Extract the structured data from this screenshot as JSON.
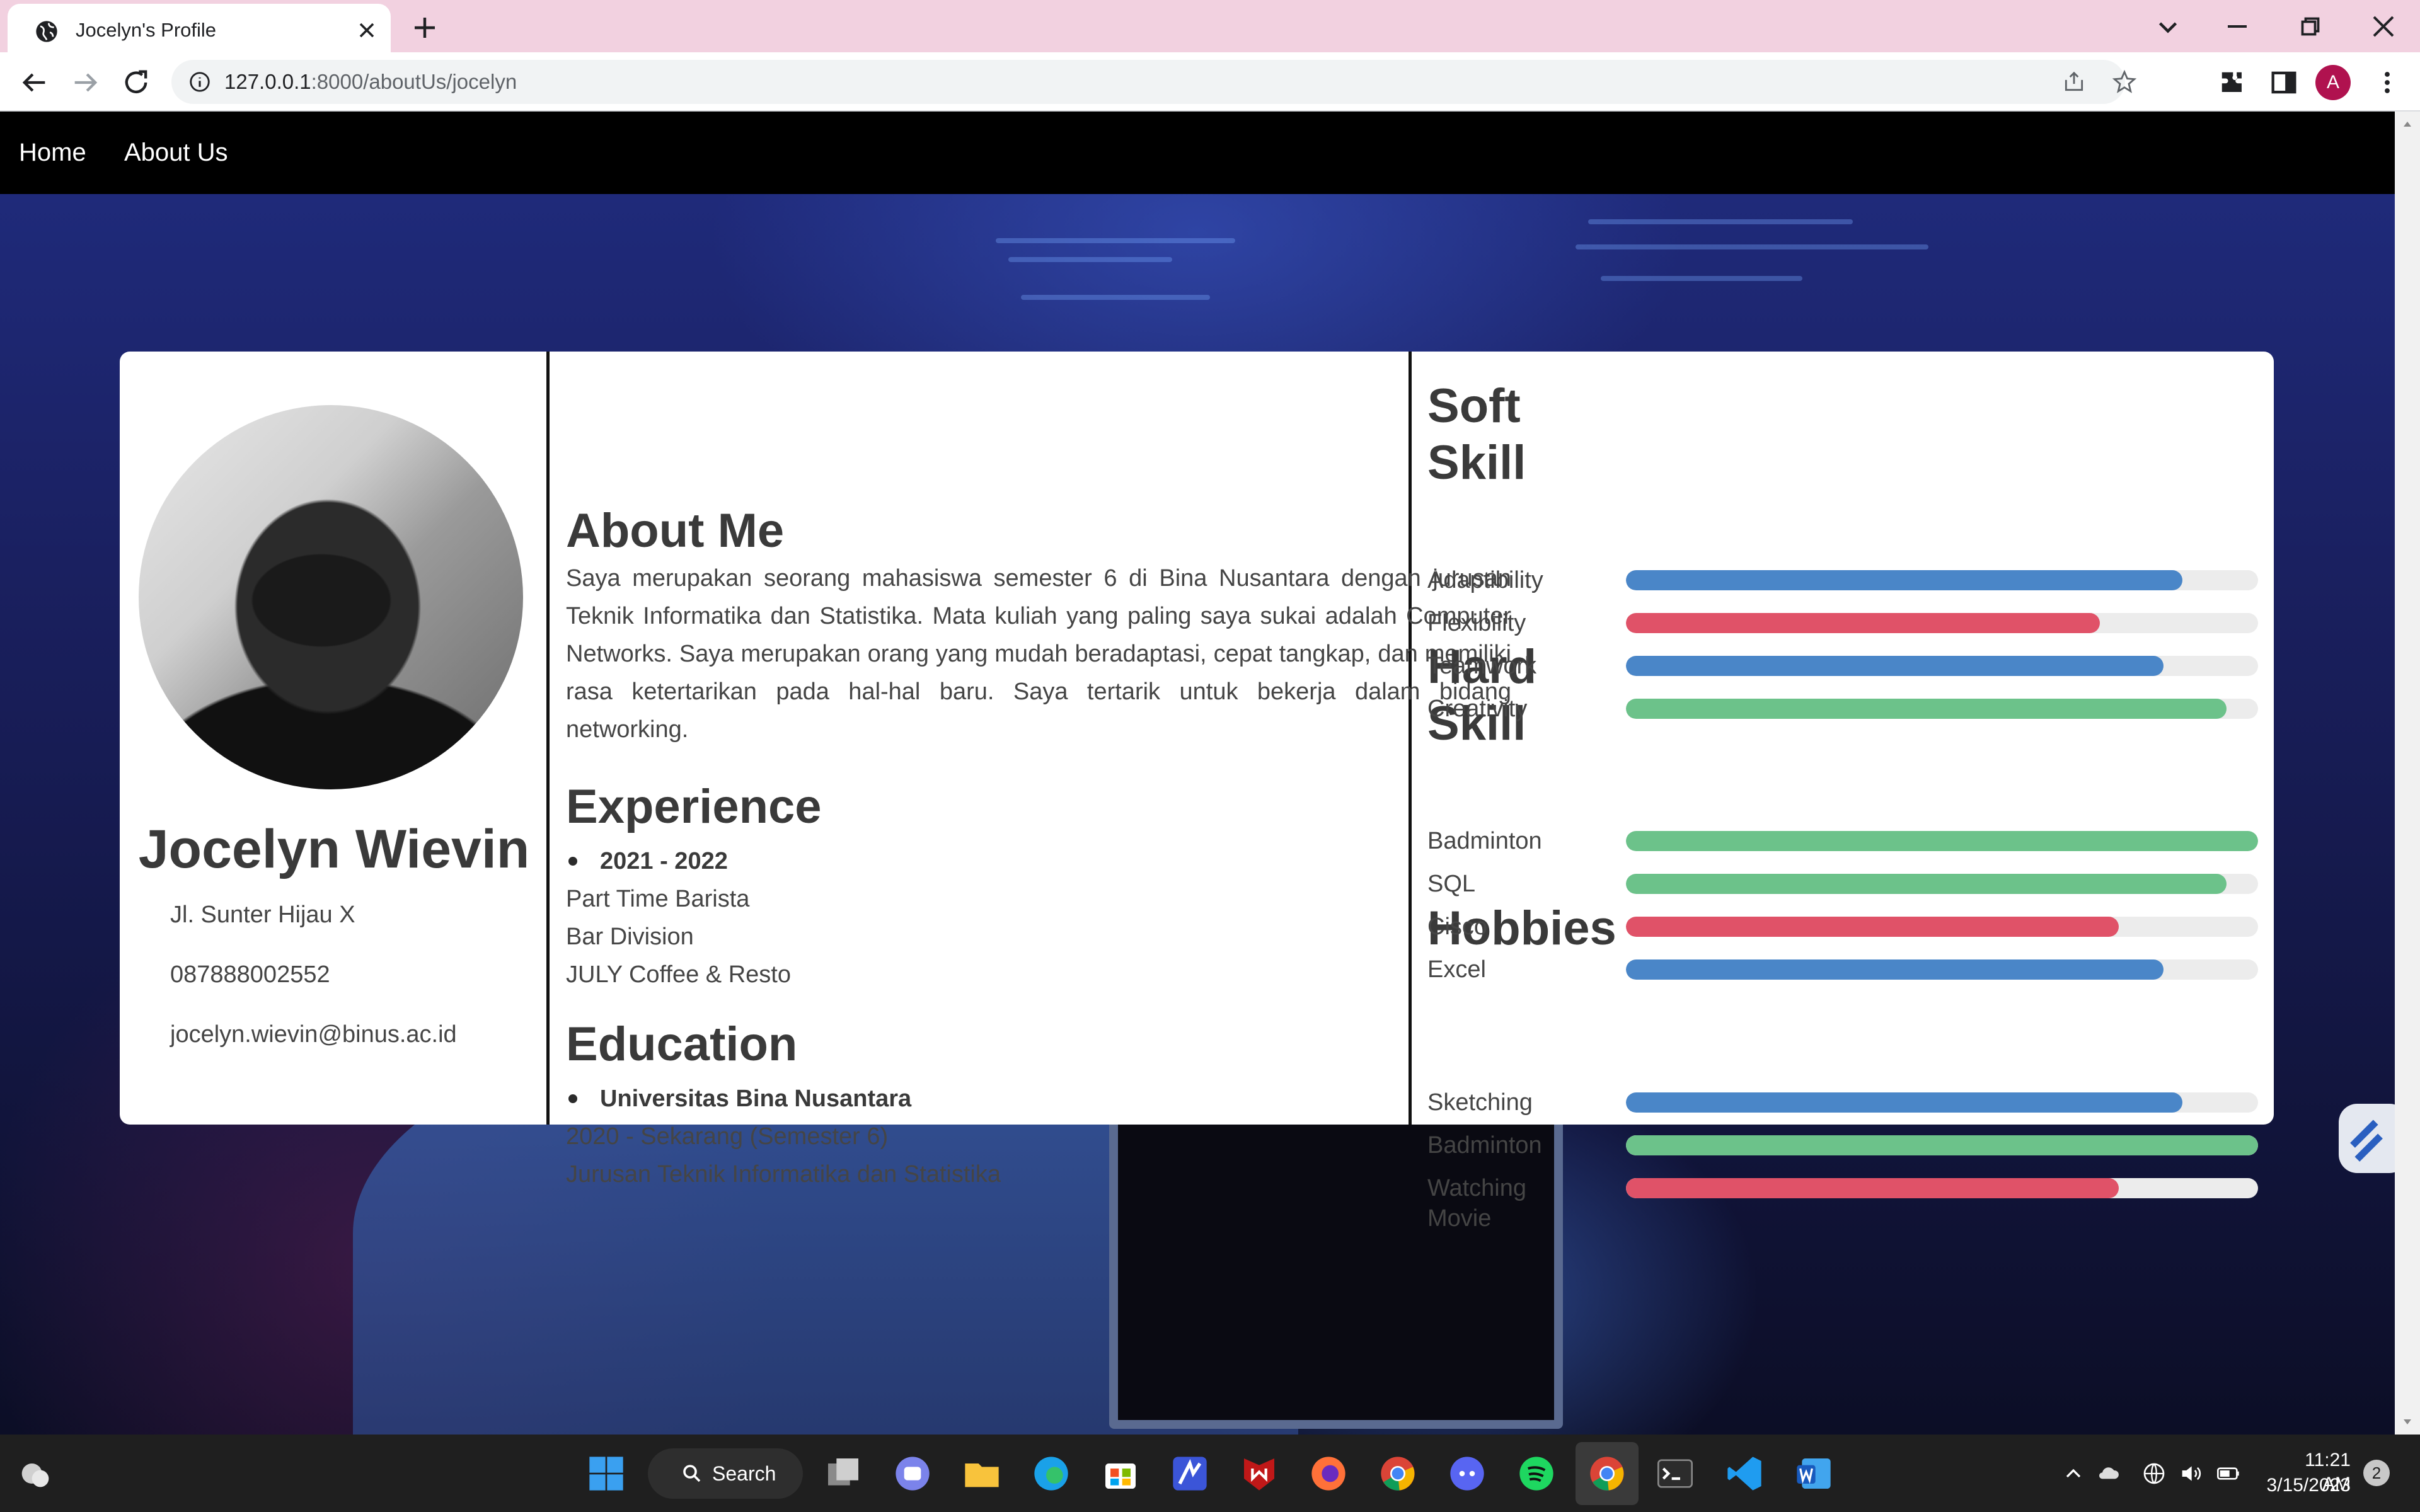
{
  "browser": {
    "tab_title": "Jocelyn's Profile",
    "url_host": "127.0.0.1",
    "url_path": ":8000/aboutUs/jocelyn",
    "profile_initial": "A"
  },
  "nav": {
    "home": "Home",
    "about": "About Us"
  },
  "profile": {
    "name": "Jocelyn Wievin",
    "address": "Jl. Sunter Hijau X",
    "phone": "087888002552",
    "email": "jocelyn.wievin@binus.ac.id"
  },
  "about": {
    "title": "About Me",
    "text": "Saya merupakan seorang mahasiswa semester 6 di Bina Nusantara dengan jurusan Teknik Informatika dan Statistika. Mata kuliah yang paling saya sukai adalah Computer Networks. Saya merupakan orang yang mudah beradaptasi, cepat tangkap, dan memiliki rasa ketertarikan pada hal-hal baru. Saya tertarik untuk bekerja dalam bidang networking."
  },
  "experience": {
    "title": "Experience",
    "period": "2021 - 2022",
    "role": "Part Time Barista",
    "division": "Bar Division",
    "company": "JULY Coffee & Resto"
  },
  "education": {
    "title": "Education",
    "school": "Universitas Bina Nusantara",
    "period": "2020 - Sekarang (Semester 6)",
    "major": "Jurusan Teknik Informatika dan Statistika"
  },
  "skills": {
    "soft_title": "Soft Skill",
    "soft": [
      {
        "label": "Adaptibility",
        "level": 0.88,
        "color": "#4a86c8"
      },
      {
        "label": "Flexibility",
        "level": 0.75,
        "color": "#e05268"
      },
      {
        "label": "Teamwork",
        "level": 0.85,
        "color": "#4a86c8"
      },
      {
        "label": "Creativity",
        "level": 0.95,
        "color": "#6cc28a"
      }
    ],
    "hard_title": "Hard Skill",
    "hard": [
      {
        "label": "Badminton",
        "level": 1.0,
        "color": "#6cc28a"
      },
      {
        "label": "SQL",
        "level": 0.95,
        "color": "#6cc28a"
      },
      {
        "label": "Cisco",
        "level": 0.78,
        "color": "#e05268"
      },
      {
        "label": "Excel",
        "level": 0.85,
        "color": "#4a86c8"
      }
    ],
    "hobbies_title": "Hobbies",
    "hobbies": [
      {
        "label": "Sketching",
        "level": 0.88,
        "color": "#4a86c8"
      },
      {
        "label": "Badminton",
        "level": 1.0,
        "color": "#6cc28a"
      },
      {
        "label": "Watching Movie",
        "level": 0.78,
        "color": "#e05268"
      }
    ]
  },
  "taskbar": {
    "search_label": "Search",
    "time": "11:21 AM",
    "date": "3/15/2023",
    "notifications": "2"
  }
}
